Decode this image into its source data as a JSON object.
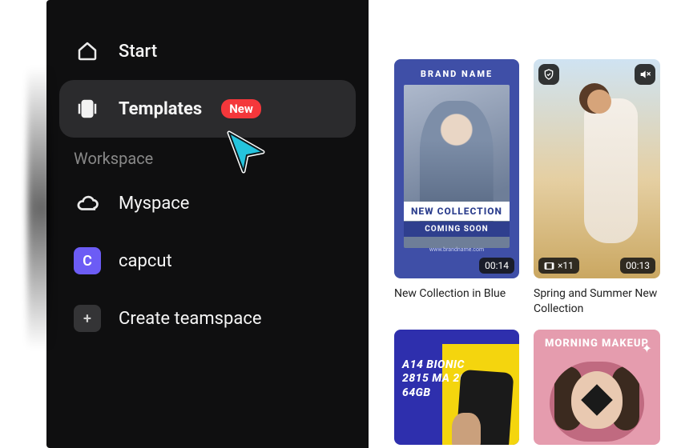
{
  "sidebar": {
    "start_label": "Start",
    "templates_label": "Templates",
    "templates_badge": "New",
    "section_label": "Workspace",
    "myspace_label": "Myspace",
    "capcut_label": "capcut",
    "capcut_initial": "C",
    "create_label": "Create teamspace",
    "plus_glyph": "+"
  },
  "cards": {
    "c1": {
      "brand": "BRAND NAME",
      "line1": "NEW COLLECTION",
      "line2": "COMING SOON",
      "tiny": "www.brandname.com",
      "duration": "00:14",
      "title": "New Collection in Blue"
    },
    "c2": {
      "duration": "00:13",
      "clips": "×11",
      "title": "Spring and Summer New Collection"
    },
    "c3": {
      "specs": "A14 BIONIC 2815 MA 20W 64GB"
    },
    "c4": {
      "heading": "MORNING MAKEUP",
      "sparkle": "✦"
    }
  }
}
